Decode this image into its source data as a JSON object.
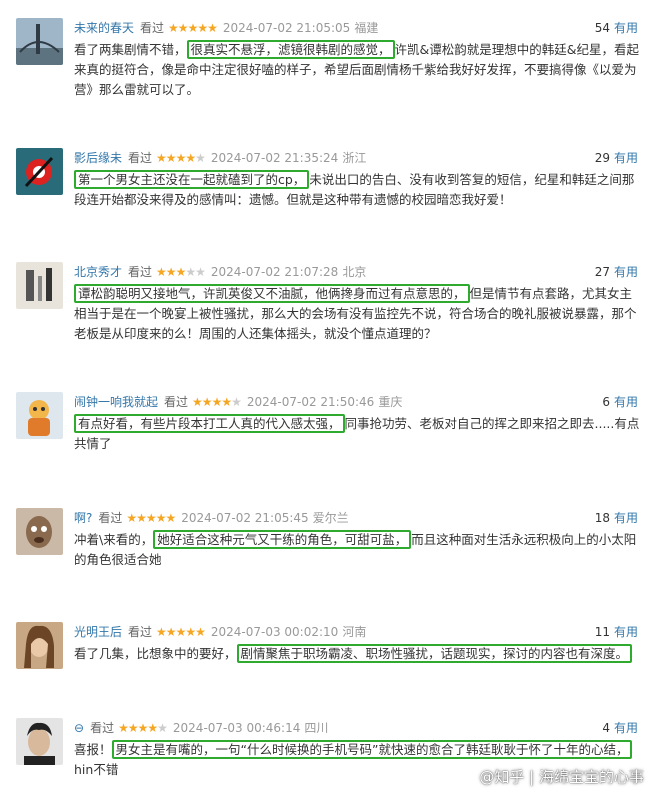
{
  "reviews": [
    {
      "user": "未来的春天",
      "status": "看过",
      "stars": 5,
      "date": "2024-07-02 21:05:05",
      "location": "福建",
      "votes": "54",
      "useful": "有用",
      "text_pre": "看了两集剧情不错，",
      "highlight": "很真实不悬浮，滤镜很韩剧的感觉，",
      "text_post": "许凯&谭松韵就是理想中的韩廷&纪星，看起来真的挺符合，像是命中注定很好嗑的样子，希望后面剧情杨千紫给我好好发挥，不要搞得像《以爱为营》那么雷就可以了。"
    },
    {
      "user": "影后缘未",
      "status": "看过",
      "stars": 4,
      "date": "2024-07-02 21:35:24",
      "location": "浙江",
      "votes": "29",
      "useful": "有用",
      "text_pre": "",
      "highlight": "第一个男女主还没在一起就磕到了的cp，",
      "text_post": "未说出口的告白、没有收到答复的短信，纪星和韩廷之间那段连开始都没来得及的感情叫：遗憾。但就是这种带有遗憾的校园暗恋我好爱！"
    },
    {
      "user": "北京秀才",
      "status": "看过",
      "stars": 3,
      "date": "2024-07-02 21:07:28",
      "location": "北京",
      "votes": "27",
      "useful": "有用",
      "text_pre": "",
      "highlight": "谭松韵聪明又接地气，许凯英俊又不油腻，他俩搀身而过有点意思的，",
      "text_post": "但是情节有点套路，尤其女主相当于是在一个晚宴上被性骚扰，那么大的会场有没有监控先不说，符合场合的晚礼服被说暴露，那个老板是从印度来的么！周围的人还集体摇头，就没个懂点道理的？"
    },
    {
      "user": "闹钟一响我就起",
      "status": "看过",
      "stars": 4,
      "date": "2024-07-02 21:50:46",
      "location": "重庆",
      "votes": "6",
      "useful": "有用",
      "text_pre": "",
      "highlight": "有点好看，有些片段本打工人真的代入感太强，",
      "text_post": "同事抢功劳、老板对自己的挥之即来招之即去.....有点共情了"
    },
    {
      "user": "啊?",
      "status": "看过",
      "stars": 5,
      "date": "2024-07-02 21:05:45",
      "location": "爱尔兰",
      "votes": "18",
      "useful": "有用",
      "text_pre": "冲着\\来看的，",
      "highlight": "她好适合这种元气又干练的角色，可甜可盐，",
      "text_post": "而且这种面对生活永远积极向上的小太阳的角色很适合她"
    },
    {
      "user": "光明王后",
      "status": "看过",
      "stars": 5,
      "date": "2024-07-03 00:02:10",
      "location": "河南",
      "votes": "11",
      "useful": "有用",
      "text_pre": "看了几集，比想象中的要好，",
      "highlight": "剧情聚焦于职场霸凌、职场性骚扰，话题现实，探讨的内容也有深度。",
      "text_post": ""
    },
    {
      "user": "⊖",
      "status": "看过",
      "stars": 4,
      "date": "2024-07-03 00:46:14",
      "location": "四川",
      "votes": "4",
      "useful": "有用",
      "text_pre": "喜报！",
      "highlight": "男女主是有嘴的，一句“什么时候换的手机号码”就快速的愈合了韩廷耿耿于怀了十年的心结，",
      "text_post": "hin不错"
    }
  ],
  "watermark": "@知乎 | 海绵宝宝的心事",
  "colors": {
    "highlight_border": "#2eaa2e",
    "username": "#3377aa",
    "star": "#f5a623"
  }
}
